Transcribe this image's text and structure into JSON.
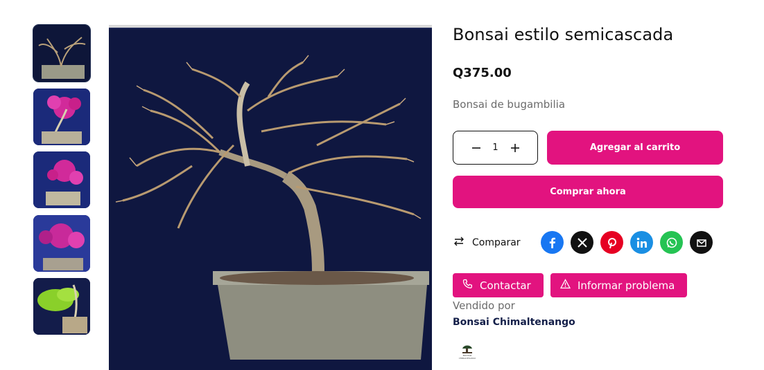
{
  "product": {
    "title": "Bonsai estilo semicascada",
    "price": "Q375.00",
    "description": "Bonsai de bugambilia"
  },
  "quantity": {
    "value": "1",
    "decrease_icon": "minus-icon",
    "increase_icon": "plus-icon"
  },
  "buttons": {
    "add_to_cart": "Agregar al carrito",
    "buy_now": "Comprar ahora",
    "compare": "Comparar",
    "contact": "Contactar",
    "report": "Informar problema"
  },
  "share": [
    {
      "name": "facebook",
      "icon": "facebook-icon",
      "color": "#1877f2"
    },
    {
      "name": "x",
      "icon": "x-icon",
      "color": "#111111"
    },
    {
      "name": "pinterest",
      "icon": "pinterest-icon",
      "color": "#e60023"
    },
    {
      "name": "linkedin",
      "icon": "linkedin-icon",
      "color": "#1a8fe3"
    },
    {
      "name": "whatsapp",
      "icon": "whatsapp-icon",
      "color": "#25c353"
    },
    {
      "name": "email",
      "icon": "email-icon",
      "color": "#111111"
    }
  ],
  "vendor": {
    "label": "Vendido por",
    "name": "Bonsai Chimaltenango",
    "logo_text": "BONSAI CHIMALTENANGO"
  },
  "colors": {
    "accent": "#e2137f",
    "navy": "#15204a",
    "muted": "#6b6b6b"
  },
  "gallery": {
    "thumbnails": 5,
    "active_index": 0
  }
}
